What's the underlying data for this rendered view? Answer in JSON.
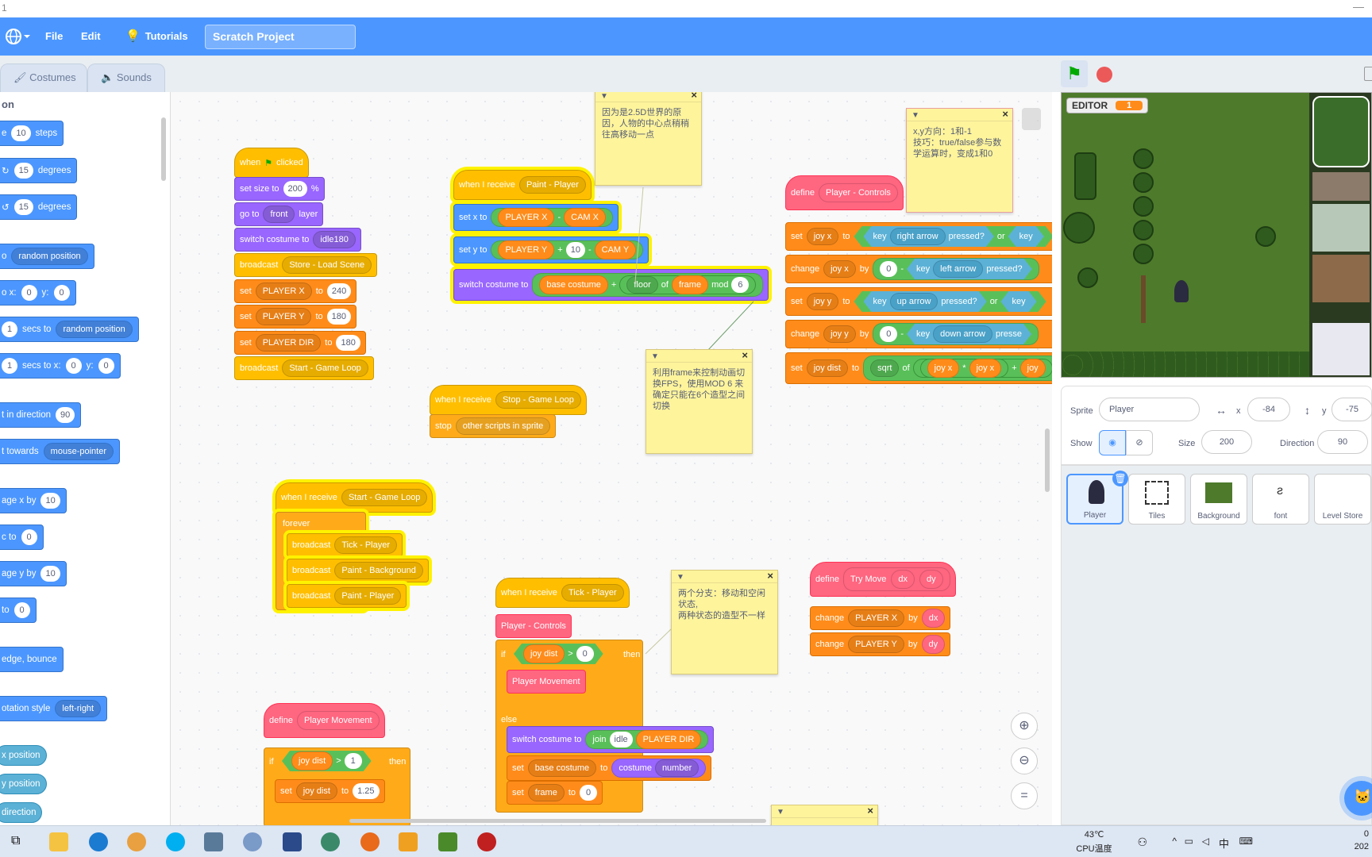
{
  "titlebar": {
    "num": "1",
    "min": "—"
  },
  "menu": {
    "file": "File",
    "edit": "Edit",
    "tutorials": "Tutorials",
    "project": "Scratch Project"
  },
  "tabs": {
    "costumes": "Costumes",
    "sounds": "Sounds"
  },
  "palette": {
    "header": "on",
    "move_pre": "e",
    "move_val": "10",
    "move_post": "steps",
    "turn_r": "15",
    "turn_l": "15",
    "degrees": "degrees",
    "goto_pre": "o",
    "goto": "random position",
    "gotoxy_pre": "o x:",
    "gx": "0",
    "gy_lbl": "y:",
    "gy": "0",
    "glide_val": "1",
    "glide_mid": "secs to",
    "glide_to": "random position",
    "glide2_val": "1",
    "glide2_mid": "secs to x:",
    "g2x": "0",
    "g2y_lbl": "y:",
    "g2y": "0",
    "dir_pre": "t in direction",
    "dir_val": "90",
    "towards_pre": "t towards",
    "towards": "mouse-pointer",
    "chx_pre": "age x by",
    "chx": "10",
    "setx_pre": "c to",
    "setx": "0",
    "chy_pre": "age y by",
    "chy": "10",
    "sety_pre": "to",
    "sety": "0",
    "bounce": "edge, bounce",
    "rot_pre": "otation style",
    "rot": "left-right",
    "xpos": "x position",
    "ypos": "y position",
    "dirr": "direction"
  },
  "scripts": {
    "s1": {
      "when": "when",
      "clicked": "clicked",
      "setsize": "set size to",
      "size": "200",
      "pct": "%",
      "goto": "go to",
      "front": "front",
      "layer": "layer",
      "switch": "switch costume to",
      "idle": "idle180",
      "bc": "broadcast",
      "store": "Store - Load Scene",
      "set": "set",
      "to": "to",
      "px": "PLAYER X",
      "pxv": "240",
      "py": "PLAYER Y",
      "pyv": "180",
      "pd": "PLAYER DIR",
      "pdv": "180",
      "start": "Start - Game Loop"
    },
    "s2": {
      "wr": "when I receive",
      "msg": "Paint - Player",
      "setx": "set x to",
      "px": "PLAYER X",
      "minus": "-",
      "camx": "CAM X",
      "sety": "set y to",
      "py": "PLAYER Y",
      "plus": "+",
      "ten": "10",
      "camy": "CAM Y",
      "switch": "switch costume to",
      "base": "base costume",
      "floor": "floor",
      "of": "of",
      "frame": "frame",
      "mod": "mod",
      "six": "6"
    },
    "s3": {
      "wr": "when I receive",
      "msg": "Stop - Game Loop",
      "stop": "stop",
      "opt": "other scripts in sprite"
    },
    "s4": {
      "define": "define",
      "name": "Player - Controls",
      "set": "set",
      "change": "change",
      "joyx": "joy x",
      "joyy": "joy y",
      "joyd": "joy dist",
      "to": "to",
      "by": "by",
      "key": "key",
      "ra": "right arrow",
      "la": "left arrow",
      "ua": "up arrow",
      "da": "down arrow",
      "pressed": "pressed?",
      "or": "or",
      "zero": "0",
      "minus": "-",
      "sqrt": "sqrt",
      "of": "of",
      "times": "*",
      "plus": "+",
      "joycut": "joy",
      "keycut": "key",
      "pressedcut": "presse"
    },
    "s5": {
      "wr": "when I receive",
      "msg": "Start - Game Loop",
      "forever": "forever",
      "bc": "broadcast",
      "m1": "Tick - Player",
      "m2": "Paint - Background",
      "m3": "Paint - Player"
    },
    "s6": {
      "wr": "when I receive",
      "msg": "Tick - Player",
      "pc": "Player - Controls",
      "if": "if",
      "jd": "joy dist",
      "gt": ">",
      "zero": "0",
      "then": "then",
      "pm": "Player Movement",
      "else": "else",
      "switch": "switch costume to",
      "join": "join",
      "idle": "idle",
      "pdir": "PLAYER DIR",
      "set": "set",
      "base": "base costume",
      "to": "to",
      "costume": "costume",
      "number": "number",
      "frame": "frame",
      "fzero": "0"
    },
    "s7": {
      "define": "define",
      "name": "Try Move",
      "dx": "dx",
      "dy": "dy",
      "change": "change",
      "px": "PLAYER X",
      "py": "PLAYER Y",
      "by": "by"
    },
    "s8": {
      "define": "define",
      "name": "Player Movement",
      "if": "if",
      "jd": "joy dist",
      "gt": ">",
      "one": "1",
      "then": "then",
      "set": "set",
      "to": "to",
      "v": "1.25"
    }
  },
  "notes": {
    "n1": "因为是2.5D世界的原因，人物的中心点稍稍往高移动一点",
    "n2": "x,y方向：1和-1\n技巧：true/false参与数学运算时，变成1和0",
    "n3": "利用frame来控制动画切换FPS，使用MOD 6 来确定只能在6个造型之间切换",
    "n4": "两个分支：移动和空闲状态,\n两种状态的造型不一样"
  },
  "stage": {
    "var_name": "EDITOR",
    "var_val": "1"
  },
  "sprite_info": {
    "sprite_lbl": "Sprite",
    "name": "Player",
    "x_lbl": "x",
    "x": "-84",
    "y_lbl": "y",
    "y": "-75",
    "show_lbl": "Show",
    "size_lbl": "Size",
    "size": "200",
    "dir_lbl": "Direction",
    "dir": "90"
  },
  "sprites": [
    "Player",
    "Tiles",
    "Background",
    "font",
    "Level Store"
  ],
  "tray": {
    "temp": "43℃",
    "cpu": "CPU温度",
    "lang": "中",
    "clock": "0",
    "year": "202"
  }
}
